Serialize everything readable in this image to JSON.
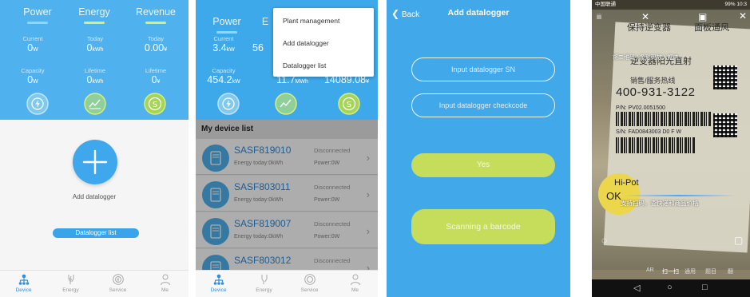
{
  "dashboard": {
    "tabs": [
      {
        "label": "Power",
        "bar_color": "#8fd7ff"
      },
      {
        "label": "Energy",
        "bar_color": "#d6ef7b"
      },
      {
        "label": "Revenue",
        "bar_color": "#d6ef7b"
      }
    ]
  },
  "panel1": {
    "current": {
      "label": "Current",
      "value": "0",
      "unit": "W"
    },
    "today": {
      "label": "Today",
      "value": "0",
      "unit": "kWh"
    },
    "today_rev": {
      "label": "Today",
      "value": "0.00",
      "unit": "¥"
    },
    "capacity": {
      "label": "Capacity",
      "value": "0",
      "unit": "W"
    },
    "lifetime": {
      "label": "Lifetime",
      "value": "0",
      "unit": "kWh"
    },
    "lifetime_rev": {
      "label": "Lifetime",
      "value": "0",
      "unit": "¥"
    },
    "add_label": "Add datalogger",
    "datalogger_list_button": "Datalogger list"
  },
  "panel2": {
    "tab_power": "Power",
    "tab_energy_partial": "E",
    "current": {
      "label": "Current",
      "value": "3.4",
      "unit": "kW"
    },
    "today_partial": {
      "value": "56"
    },
    "capacity": {
      "label": "Capacity",
      "value": "454.2",
      "unit": "kW"
    },
    "lifetime_partial": {
      "label": "L",
      "value": "11.7",
      "unit": "MWh"
    },
    "lifetime_rev": {
      "value": "14089.08",
      "unit": "¥"
    },
    "menu": [
      "Plant management",
      "Add datalogger",
      "Datalogger list"
    ],
    "list_title": "My device list",
    "devices": [
      {
        "name": "SASF819010",
        "energy": "Energy today:0kWh",
        "status": "Disconnected",
        "power": "Power:0W"
      },
      {
        "name": "SASF803011",
        "energy": "Energy today:0kWh",
        "status": "Disconnected",
        "power": "Power:0W"
      },
      {
        "name": "SASF819007",
        "energy": "Energy today:0kWh",
        "status": "Disconnected",
        "power": "Power:0W"
      },
      {
        "name": "SASF803012",
        "energy": "",
        "status": "Disconnected",
        "power": ""
      }
    ]
  },
  "panel3": {
    "back": "Back",
    "title": "Add datalogger",
    "sn_placeholder": "Input datalogger SN",
    "checkcode_placeholder": "Input datalogger checkcode",
    "yes_button": "Yes",
    "scan_button": "Scanning a barcode"
  },
  "panel4": {
    "carrier": "中国联通",
    "battery_time": "99% 10:3",
    "scan_hint": "将二维码 / 条形码放入框内",
    "hotline": "销售/服务热线",
    "phone": "400-931-3122",
    "pn": "P/N: PV02.0051500",
    "sn": "S/N: FAD0843003   D0  F W",
    "hipot": "Hi-Pot",
    "ok": "OK",
    "support_text": "支持扫码，查快递和商品价格",
    "label_top1": "保持逆变器",
    "label_top2": "面板通风",
    "label_mid": "逆变器阳光直射",
    "bottom_tabs": [
      "AR",
      "扫一扫",
      "通用",
      "题目",
      "翻"
    ]
  },
  "nav": [
    {
      "label": "Device",
      "icon": "device-icon"
    },
    {
      "label": "Energy",
      "icon": "energy-icon"
    },
    {
      "label": "Service",
      "icon": "service-icon"
    },
    {
      "label": "Me",
      "icon": "me-icon"
    }
  ]
}
